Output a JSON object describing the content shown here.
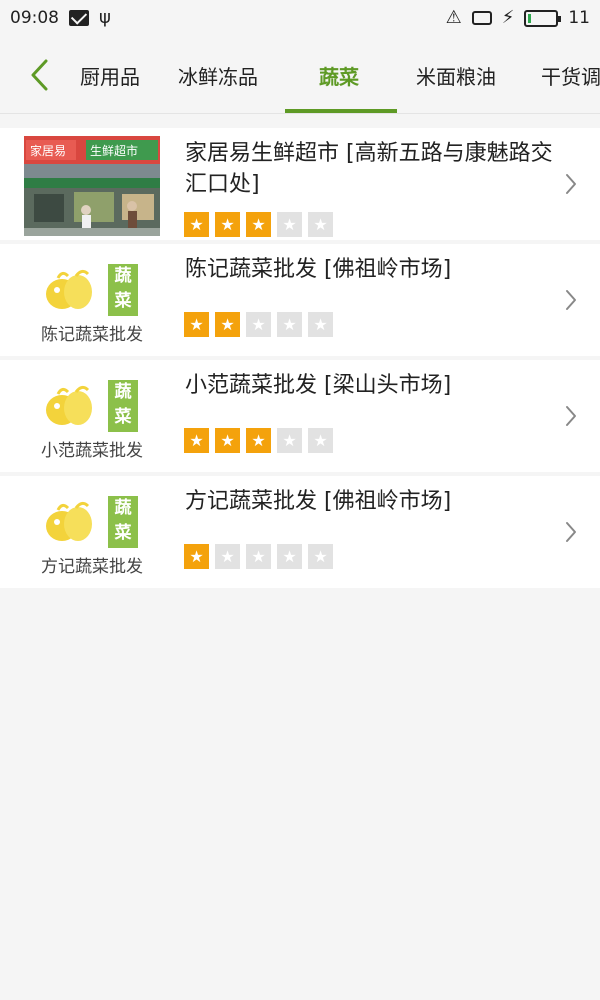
{
  "status_bar": {
    "time": "09:08",
    "icons": [
      "mail-icon",
      "usb-icon",
      "alert-icon",
      "screen-icon",
      "charging-icon",
      "battery-icon"
    ],
    "battery_level": "11",
    "battery_fraction": 0.11
  },
  "tabs": [
    {
      "label": "厨用品",
      "active": false
    },
    {
      "label": "冰鲜冻品",
      "active": false
    },
    {
      "label": "蔬菜",
      "active": true
    },
    {
      "label": "米面粮油",
      "active": false
    },
    {
      "label": "干货调",
      "active": false
    }
  ],
  "theme": {
    "accent": "#5e9a25",
    "star_on": "#f4a20c",
    "star_off": "#e2e2e2"
  },
  "shops": [
    {
      "title": "家居易生鲜超市 [高新五路与康魅路交汇口处]",
      "rating": 3,
      "image": {
        "kind": "photo",
        "sign_text": [
          "家居易",
          "生鲜超市"
        ]
      }
    },
    {
      "title": "陈记蔬菜批发 [佛祖岭市场]",
      "rating": 2,
      "image": {
        "kind": "logo",
        "badge": "蔬菜",
        "name": "陈记蔬菜批发"
      }
    },
    {
      "title": "小范蔬菜批发 [梁山头市场]",
      "rating": 3,
      "image": {
        "kind": "logo",
        "badge": "蔬菜",
        "name": "小范蔬菜批发"
      }
    },
    {
      "title": "方记蔬菜批发 [佛祖岭市场]",
      "rating": 1,
      "image": {
        "kind": "logo",
        "badge": "蔬菜",
        "name": "方记蔬菜批发"
      }
    }
  ],
  "max_rating": 5
}
